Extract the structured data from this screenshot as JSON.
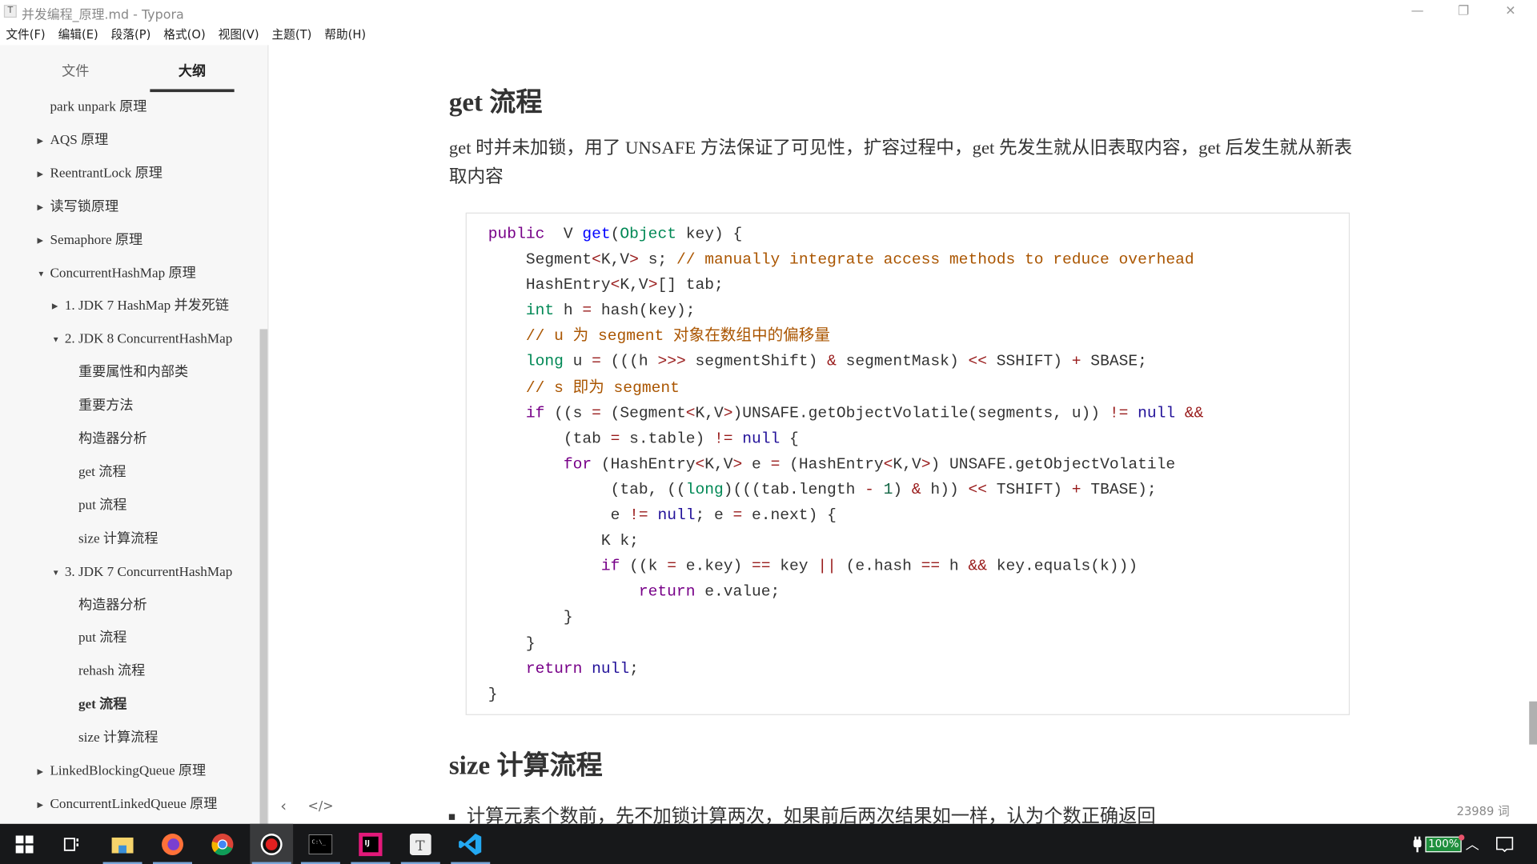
{
  "window": {
    "title": "并发编程_原理.md - Typora",
    "app_icon": "T",
    "minimize": "—",
    "restore": "❐",
    "close": "✕"
  },
  "menu": [
    "文件(F)",
    "编辑(E)",
    "段落(P)",
    "格式(O)",
    "视图(V)",
    "主题(T)",
    "帮助(H)"
  ],
  "sidebar": {
    "tabs": [
      {
        "label": "文件",
        "active": false
      },
      {
        "label": "大纲",
        "active": true
      }
    ],
    "outline": [
      {
        "label": "park unpark 原理",
        "level": 0,
        "toggle": "none"
      },
      {
        "label": "AQS 原理",
        "level": 0,
        "toggle": "collapsed"
      },
      {
        "label": "ReentrantLock 原理",
        "level": 0,
        "toggle": "collapsed"
      },
      {
        "label": "读写锁原理",
        "level": 0,
        "toggle": "collapsed"
      },
      {
        "label": "Semaphore 原理",
        "level": 0,
        "toggle": "collapsed"
      },
      {
        "label": "ConcurrentHashMap 原理",
        "level": 0,
        "toggle": "expanded"
      },
      {
        "label": "1. JDK 7 HashMap 并发死链",
        "level": 1,
        "toggle": "collapsed"
      },
      {
        "label": "2. JDK 8 ConcurrentHashMap",
        "level": 1,
        "toggle": "expanded"
      },
      {
        "label": "重要属性和内部类",
        "level": 2,
        "toggle": "none"
      },
      {
        "label": "重要方法",
        "level": 2,
        "toggle": "none"
      },
      {
        "label": "构造器分析",
        "level": 2,
        "toggle": "none"
      },
      {
        "label": "get 流程",
        "level": 2,
        "toggle": "none"
      },
      {
        "label": "put 流程",
        "level": 2,
        "toggle": "none"
      },
      {
        "label": "size 计算流程",
        "level": 2,
        "toggle": "none"
      },
      {
        "label": "3. JDK 7 ConcurrentHashMap",
        "level": 1,
        "toggle": "expanded"
      },
      {
        "label": "构造器分析",
        "level": 2,
        "toggle": "none"
      },
      {
        "label": "put 流程",
        "level": 2,
        "toggle": "none"
      },
      {
        "label": "rehash 流程",
        "level": 2,
        "toggle": "none"
      },
      {
        "label": "get 流程",
        "level": 2,
        "toggle": "none",
        "active": true
      },
      {
        "label": "size 计算流程",
        "level": 2,
        "toggle": "none"
      },
      {
        "label": "LinkedBlockingQueue 原理",
        "level": 0,
        "toggle": "collapsed"
      },
      {
        "label": "ConcurrentLinkedQueue 原理",
        "level": 0,
        "toggle": "collapsed"
      }
    ],
    "footer": {
      "back": "‹",
      "source": "</>"
    }
  },
  "content": {
    "heading1": "get 流程",
    "paragraph": "get 时并未加锁，用了 UNSAFE 方法保证了可见性，扩容过程中，get 先发生就从旧表取内容，get 后发生就从新表取内容",
    "code": [
      [
        [
          "kw",
          "public"
        ],
        [
          "",
          "  V "
        ],
        [
          "def",
          "get"
        ],
        [
          "",
          "("
        ],
        [
          "ty",
          "Object"
        ],
        [
          "",
          " key) {"
        ]
      ],
      [
        [
          "",
          "    Segment"
        ],
        [
          "op",
          "<"
        ],
        [
          "",
          "K,V"
        ],
        [
          "op",
          ">"
        ],
        [
          "",
          " s; "
        ],
        [
          "cm",
          "// manually integrate access methods to reduce overhead"
        ]
      ],
      [
        [
          "",
          "    HashEntry"
        ],
        [
          "op",
          "<"
        ],
        [
          "",
          "K,V"
        ],
        [
          "op",
          ">"
        ],
        [
          "",
          "[] tab;"
        ]
      ],
      [
        [
          "",
          "    "
        ],
        [
          "ty",
          "int"
        ],
        [
          "",
          " h "
        ],
        [
          "op",
          "="
        ],
        [
          "",
          " hash(key);"
        ]
      ],
      [
        [
          "",
          "    "
        ],
        [
          "cm",
          "// u 为 segment 对象在数组中的偏移量"
        ]
      ],
      [
        [
          "",
          "    "
        ],
        [
          "ty",
          "long"
        ],
        [
          "",
          " u "
        ],
        [
          "op",
          "="
        ],
        [
          "",
          " (((h "
        ],
        [
          "op",
          ">>>"
        ],
        [
          "",
          " segmentShift) "
        ],
        [
          "op",
          "&"
        ],
        [
          "",
          " segmentMask) "
        ],
        [
          "op",
          "<<"
        ],
        [
          "",
          " SSHIFT) "
        ],
        [
          "op",
          "+"
        ],
        [
          "",
          " SBASE;"
        ]
      ],
      [
        [
          "",
          "    "
        ],
        [
          "cm",
          "// s 即为 segment"
        ]
      ],
      [
        [
          "",
          "    "
        ],
        [
          "kw",
          "if"
        ],
        [
          "",
          " ((s "
        ],
        [
          "op",
          "="
        ],
        [
          "",
          " (Segment"
        ],
        [
          "op",
          "<"
        ],
        [
          "",
          "K,V"
        ],
        [
          "op",
          ">"
        ],
        [
          "",
          ")UNSAFE.getObjectVolatile(segments, u)) "
        ],
        [
          "op",
          "!="
        ],
        [
          "",
          " "
        ],
        [
          "at",
          "null"
        ],
        [
          "",
          " "
        ],
        [
          "op",
          "&&"
        ]
      ],
      [
        [
          "",
          "        (tab "
        ],
        [
          "op",
          "="
        ],
        [
          "",
          " s.table) "
        ],
        [
          "op",
          "!="
        ],
        [
          "",
          " "
        ],
        [
          "at",
          "null"
        ],
        [
          "",
          " {"
        ]
      ],
      [
        [
          "",
          "        "
        ],
        [
          "kw",
          "for"
        ],
        [
          "",
          " (HashEntry"
        ],
        [
          "op",
          "<"
        ],
        [
          "",
          "K,V"
        ],
        [
          "op",
          ">"
        ],
        [
          "",
          " e "
        ],
        [
          "op",
          "="
        ],
        [
          "",
          " (HashEntry"
        ],
        [
          "op",
          "<"
        ],
        [
          "",
          "K,V"
        ],
        [
          "op",
          ">"
        ],
        [
          "",
          ") UNSAFE.getObjectVolatile"
        ]
      ],
      [
        [
          "",
          "             (tab, (("
        ],
        [
          "ty",
          "long"
        ],
        [
          "",
          ")(((tab.length "
        ],
        [
          "op",
          "-"
        ],
        [
          "",
          " "
        ],
        [
          "nm",
          "1"
        ],
        [
          "",
          ") "
        ],
        [
          "op",
          "&"
        ],
        [
          "",
          " h)) "
        ],
        [
          "op",
          "<<"
        ],
        [
          "",
          " TSHIFT) "
        ],
        [
          "op",
          "+"
        ],
        [
          "",
          " TBASE);"
        ]
      ],
      [
        [
          "",
          "             e "
        ],
        [
          "op",
          "!="
        ],
        [
          "",
          " "
        ],
        [
          "at",
          "null"
        ],
        [
          "",
          "; e "
        ],
        [
          "op",
          "="
        ],
        [
          "",
          " e.next) {"
        ]
      ],
      [
        [
          "",
          "            K k;"
        ]
      ],
      [
        [
          "",
          "            "
        ],
        [
          "kw",
          "if"
        ],
        [
          "",
          " ((k "
        ],
        [
          "op",
          "="
        ],
        [
          "",
          " e.key) "
        ],
        [
          "op",
          "=="
        ],
        [
          "",
          " key "
        ],
        [
          "op",
          "||"
        ],
        [
          "",
          " (e.hash "
        ],
        [
          "op",
          "=="
        ],
        [
          "",
          " h "
        ],
        [
          "op",
          "&&"
        ],
        [
          "",
          " key.equals(k)))"
        ]
      ],
      [
        [
          "",
          "                "
        ],
        [
          "kw",
          "return"
        ],
        [
          "",
          " e.value;"
        ]
      ],
      [
        [
          "",
          "        }"
        ]
      ],
      [
        [
          "",
          "    }"
        ]
      ],
      [
        [
          "",
          "    "
        ],
        [
          "kw",
          "return"
        ],
        [
          "",
          " "
        ],
        [
          "at",
          "null"
        ],
        [
          ";",
          ""
        ]
      ],
      [
        [
          "",
          "}"
        ]
      ]
    ],
    "heading2": "size 计算流程",
    "bullet": "计算元素个数前，先不加锁计算两次，如果前后两次结果如一样，认为个数正确返回",
    "word_count": "23989 词"
  },
  "taskbar": {
    "apps": [
      "windows-start",
      "task-view",
      "file-explorer",
      "firefox",
      "chrome",
      "screen-recorder",
      "terminal",
      "intellij-idea",
      "typora",
      "vscode"
    ],
    "battery": "100%"
  },
  "colors": {
    "keyword": "#770088",
    "def": "#0000ff",
    "type": "#008855",
    "comment": "#aa5500",
    "operator": "#981a1a",
    "atom": "#221199",
    "number": "#116644"
  }
}
